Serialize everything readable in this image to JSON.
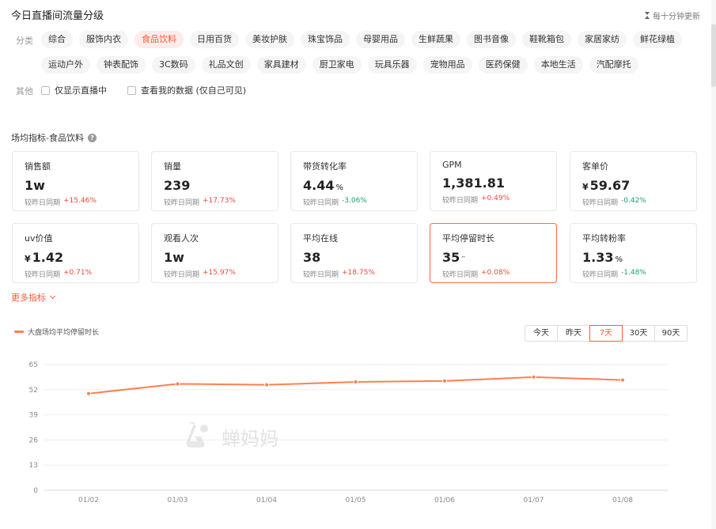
{
  "header": {
    "title": "今日直播间流量分级",
    "update_note": "每十分钟更新"
  },
  "filters": {
    "category_label": "分类",
    "categories_row1": [
      "综合",
      "服饰内衣",
      "食品饮料",
      "日用百货",
      "美妆护肤",
      "珠宝饰品",
      "母婴用品",
      "生鲜蔬果",
      "图书音像",
      "鞋靴箱包",
      "家居家纺",
      "鲜花绿植"
    ],
    "categories_row2": [
      "运动户外",
      "钟表配饰",
      "3C数码",
      "礼品文创",
      "家具建材",
      "厨卫家电",
      "玩具乐器",
      "宠物用品",
      "医药保健",
      "本地生活",
      "汽配摩托"
    ],
    "active_category": "食品饮料",
    "other_label": "其他",
    "checkbox_live": "仅显示直播中",
    "checkbox_mine": "查看我的数据 (仅自己可见)"
  },
  "section": {
    "title": "场均指标-食品饮料",
    "help_icon": "question-circle-icon"
  },
  "compare_label": "较昨日同期",
  "metrics": [
    {
      "label": "销售额",
      "prefix": "",
      "value": "1w",
      "suffix": "",
      "change": "+15.46%",
      "trend": "up"
    },
    {
      "label": "销量",
      "prefix": "",
      "value": "239",
      "suffix": "",
      "change": "+17.73%",
      "trend": "up"
    },
    {
      "label": "带货转化率",
      "prefix": "",
      "value": "4.44",
      "suffix": "%",
      "change": "-3.06%",
      "trend": "down"
    },
    {
      "label": "GPM",
      "prefix": "",
      "value": "1,381.81",
      "suffix": "",
      "change": "+0.49%",
      "trend": "up"
    },
    {
      "label": "客单价",
      "prefix": "¥",
      "value": "59.67",
      "suffix": "",
      "change": "-0.42%",
      "trend": "down"
    },
    {
      "label": "uv价值",
      "prefix": "¥",
      "value": "1.42",
      "suffix": "",
      "change": "+0.71%",
      "trend": "up"
    },
    {
      "label": "观看人次",
      "prefix": "",
      "value": "1w",
      "suffix": "",
      "change": "+15.97%",
      "trend": "up"
    },
    {
      "label": "平均在线",
      "prefix": "",
      "value": "38",
      "suffix": "",
      "change": "+18.75%",
      "trend": "up"
    },
    {
      "label": "平均停留时长",
      "prefix": "",
      "value": "35",
      "suffix": "′′",
      "change": "+0.08%",
      "trend": "up",
      "active": true
    },
    {
      "label": "平均转粉率",
      "prefix": "",
      "value": "1.33",
      "suffix": "%",
      "change": "-1.48%",
      "trend": "down"
    }
  ],
  "more_metrics": "更多指标",
  "time_range": {
    "options": [
      "今天",
      "昨天",
      "7天",
      "30天",
      "90天"
    ],
    "selected": "7天"
  },
  "colors": {
    "accent": "#ff5a3c",
    "line": "#ff7f50",
    "up": "#f04a3b",
    "down": "#1ba36b"
  },
  "watermark": {
    "text": "蝉妈妈",
    "icon": "chanmama-logo-icon"
  },
  "chart_data": {
    "type": "line",
    "x": [
      "01/02",
      "01/03",
      "01/04",
      "01/05",
      "01/06",
      "01/07",
      "01/08"
    ],
    "series": [
      {
        "name": "大盘场均平均停留时长",
        "values": [
          50,
          55,
          54.5,
          56,
          56.5,
          58.5,
          57
        ]
      }
    ],
    "yticks": [
      0,
      13,
      26,
      39,
      52,
      65
    ],
    "ylim": [
      0,
      65
    ],
    "grid": "horizontal",
    "legend_position": "top-left"
  }
}
